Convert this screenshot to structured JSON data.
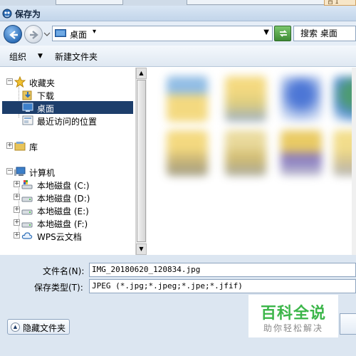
{
  "window": {
    "title": "保存为",
    "top_tab_fragment": "百 1"
  },
  "address": {
    "breadcrumb": "桌面"
  },
  "search": {
    "placeholder": "搜索 桌面"
  },
  "toolbar": {
    "organize_label": "组织",
    "new_folder_label": "新建文件夹"
  },
  "navtree": {
    "favorites": {
      "label": "收藏夹",
      "items": [
        "下载",
        "桌面",
        "最近访问的位置"
      ],
      "selected": "桌面"
    },
    "libraries": {
      "label": "库"
    },
    "computer": {
      "label": "计算机",
      "drives": [
        "本地磁盘 (C:)",
        "本地磁盘 (D:)",
        "本地磁盘 (E:)",
        "本地磁盘 (F:)"
      ],
      "cloud": "WPS云文档"
    }
  },
  "form": {
    "filename_label": "文件名(N):",
    "filename_value": "IMG_20180620_120834.jpg",
    "filetype_label": "保存类型(T):",
    "filetype_value": "JPEG (*.jpg;*.jpeg;*.jpe;*.jfif)"
  },
  "buttons": {
    "hide_folders_label": "隐藏文件夹"
  },
  "watermark": {
    "main": "百科全说",
    "sub": "助你轻松解决"
  },
  "colors": {
    "selection": "#1d3e6b",
    "watermark_green": "#3cb64a",
    "panel_bg": "#dce6f1"
  }
}
